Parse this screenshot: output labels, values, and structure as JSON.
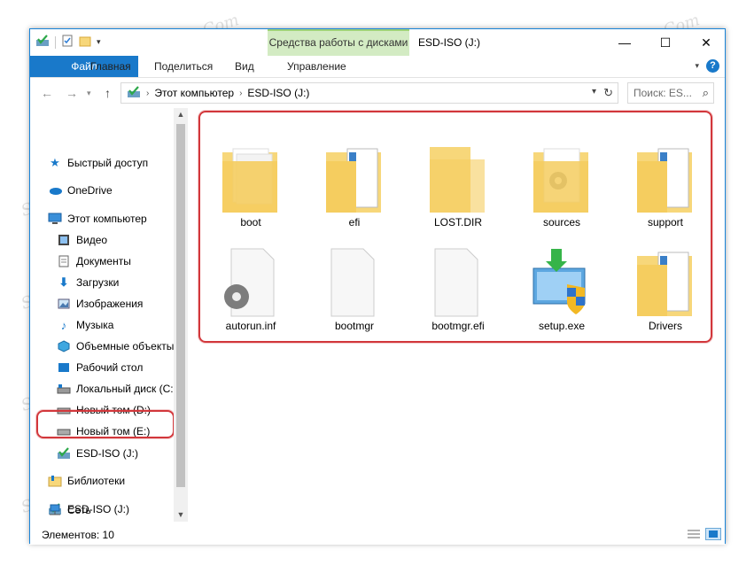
{
  "window": {
    "title": "ESD-ISO (J:)",
    "context_tab_group": "Средства работы с дисками",
    "controls": {
      "minimize": "—",
      "maximize": "☐",
      "close": "✕"
    }
  },
  "ribbon": {
    "tabs": [
      {
        "label": "Файл",
        "active": true
      },
      {
        "label": "Главная"
      },
      {
        "label": "Поделиться"
      },
      {
        "label": "Вид"
      },
      {
        "label": "Управление"
      }
    ]
  },
  "address": {
    "crumbs": [
      "Этот компьютер",
      "ESD-ISO (J:)"
    ],
    "search_placeholder": "Поиск: ES..."
  },
  "nav": {
    "items": [
      {
        "label": "Быстрый доступ",
        "icon": "star-icon"
      },
      {
        "label": "OneDrive",
        "icon": "cloud-icon"
      },
      {
        "label": "Этот компьютер",
        "icon": "computer-icon"
      },
      {
        "label": "Видео",
        "icon": "video-icon"
      },
      {
        "label": "Документы",
        "icon": "documents-icon"
      },
      {
        "label": "Загрузки",
        "icon": "download-icon"
      },
      {
        "label": "Изображения",
        "icon": "pictures-icon"
      },
      {
        "label": "Музыка",
        "icon": "music-icon"
      },
      {
        "label": "Объемные объекты",
        "icon": "3d-objects-icon"
      },
      {
        "label": "Рабочий стол",
        "icon": "desktop-icon"
      },
      {
        "label": "Локальный диск (C:",
        "icon": "local-disk-icon"
      },
      {
        "label": "Новый том (D:)",
        "icon": "drive-icon"
      },
      {
        "label": "Новый том (E:)",
        "icon": "drive-icon"
      },
      {
        "label": "ESD-ISO (J:)",
        "icon": "disc-drive-icon",
        "selected": true
      },
      {
        "label": "Библиотеки",
        "icon": "libraries-icon"
      },
      {
        "label": "ESD-ISO (J:)",
        "icon": "disc-drive-icon"
      },
      {
        "label": "Сеть",
        "icon": "network-icon"
      }
    ]
  },
  "files": [
    {
      "name": "boot",
      "type": "folder-docs"
    },
    {
      "name": "efi",
      "type": "folder-blue"
    },
    {
      "name": "LOST.DIR",
      "type": "folder-empty"
    },
    {
      "name": "sources",
      "type": "folder-gear"
    },
    {
      "name": "support",
      "type": "folder-blue"
    },
    {
      "name": "autorun.inf",
      "type": "file-gear"
    },
    {
      "name": "bootmgr",
      "type": "file-blank"
    },
    {
      "name": "bootmgr.efi",
      "type": "file-blank"
    },
    {
      "name": "setup.exe",
      "type": "setup-exe"
    },
    {
      "name": "Drivers",
      "type": "folder-blue"
    }
  ],
  "status": {
    "items_count": "Элементов: 10"
  },
  "watermark": "Soringpcrepair.Com",
  "colors": {
    "accent": "#1979ca",
    "highlight": "#d2373b",
    "folder": "#f7d77a",
    "context_tab": "#d3ebc3"
  }
}
